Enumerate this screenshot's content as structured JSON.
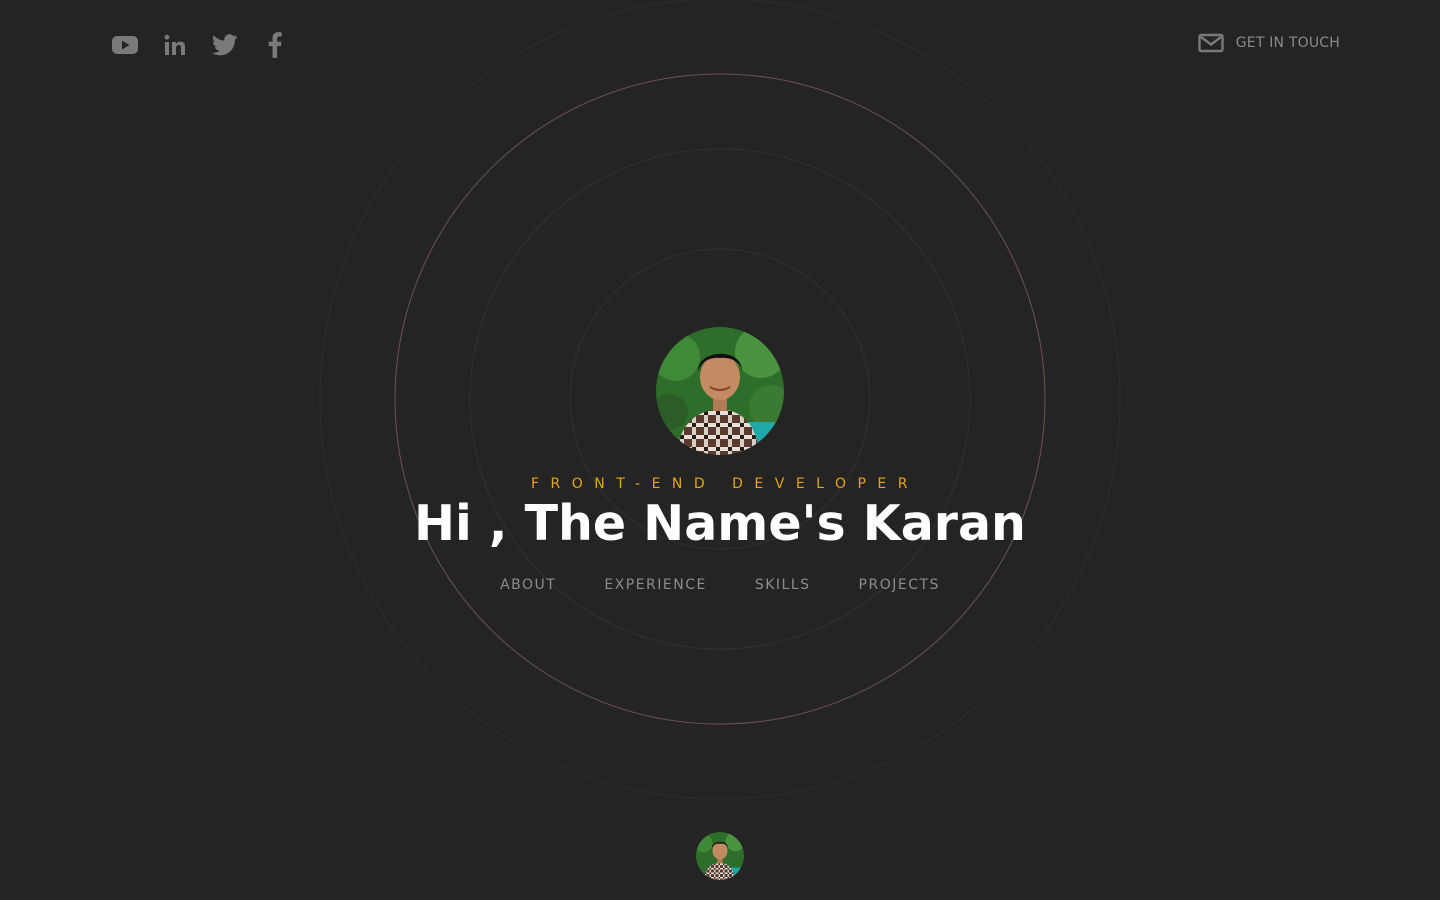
{
  "header": {
    "social": [
      {
        "icon": "youtube-icon"
      },
      {
        "icon": "linkedin-icon"
      },
      {
        "icon": "twitter-icon"
      },
      {
        "icon": "facebook-icon"
      }
    ],
    "contact": {
      "icon": "mail-icon",
      "label": "GET IN TOUCH"
    }
  },
  "hero": {
    "role": "FRONT-END DEVELOPER",
    "headline": "Hi , The Name's Karan",
    "nav": [
      "ABOUT",
      "EXPERIENCE",
      "SKILLS",
      "PROJECTS"
    ]
  },
  "colors": {
    "background": "#242424",
    "accent": "#e8a313",
    "headline": "#ffffff",
    "muted": "#8c8c8c",
    "ring_highlight": "#6b5353"
  }
}
